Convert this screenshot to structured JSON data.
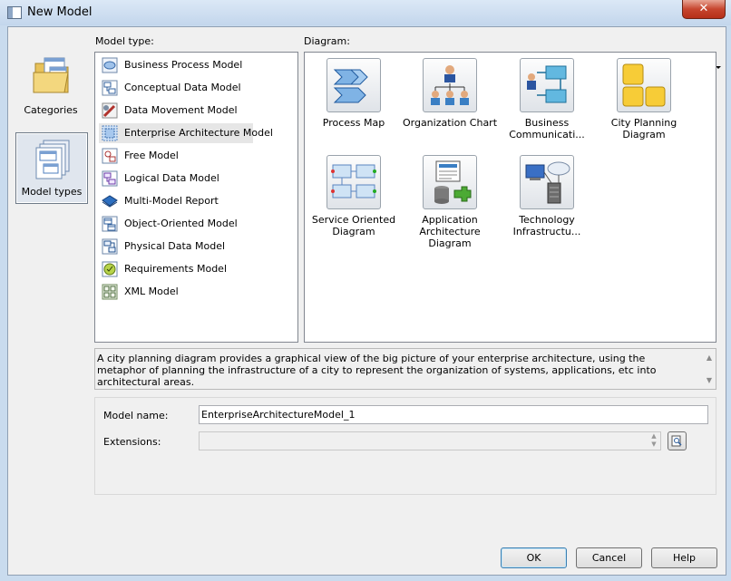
{
  "window": {
    "title": "New Model",
    "close_glyph": "✕"
  },
  "categories": [
    {
      "label": "Categories",
      "icon": "folder-icon",
      "selected": false
    },
    {
      "label": "Model types",
      "icon": "model-types-icon",
      "selected": true
    }
  ],
  "model_type_label": "Model type:",
  "diagram_label": "Diagram:",
  "model_types": [
    {
      "label": "Business Process Model",
      "icon": "business-process-model-icon"
    },
    {
      "label": "Conceptual Data Model",
      "icon": "conceptual-data-model-icon"
    },
    {
      "label": "Data Movement Model",
      "icon": "data-movement-model-icon"
    },
    {
      "label": "Enterprise Architecture Model",
      "icon": "enterprise-architecture-model-icon",
      "selected": true
    },
    {
      "label": "Free Model",
      "icon": "free-model-icon"
    },
    {
      "label": "Logical Data Model",
      "icon": "logical-data-model-icon"
    },
    {
      "label": "Multi-Model Report",
      "icon": "multi-model-report-icon"
    },
    {
      "label": "Object-Oriented Model",
      "icon": "object-oriented-model-icon"
    },
    {
      "label": "Physical Data Model",
      "icon": "physical-data-model-icon"
    },
    {
      "label": "Requirements Model",
      "icon": "requirements-model-icon"
    },
    {
      "label": "XML Model",
      "icon": "xml-model-icon"
    }
  ],
  "diagrams": [
    {
      "line1": "Process Map",
      "line2": "",
      "icon": "process-map-icon"
    },
    {
      "line1": "Organization Chart",
      "line2": "",
      "icon": "organization-chart-icon"
    },
    {
      "line1": "Business",
      "line2": "Communicati...",
      "icon": "business-communication-icon"
    },
    {
      "line1": "City Planning Diagram",
      "line2": "",
      "icon": "city-planning-icon"
    },
    {
      "line1": "Service Oriented",
      "line2": "Diagram",
      "icon": "service-oriented-icon"
    },
    {
      "line1": "Application",
      "line2": "Architecture Diagram",
      "icon": "application-architecture-icon"
    },
    {
      "line1": "Technology",
      "line2": "Infrastructu...",
      "icon": "technology-infrastructure-icon"
    }
  ],
  "description": "A city planning diagram provides a graphical view of the big picture of your enterprise architecture, using the metaphor of planning the infrastructure of a city to represent the organization of systems, applications, etc into architectural areas.",
  "form": {
    "model_name_label": "Model name:",
    "model_name_value": "EnterpriseArchitectureModel_1",
    "extensions_label": "Extensions:",
    "extensions_value": ""
  },
  "buttons": {
    "ok": "OK",
    "cancel": "Cancel",
    "help": "Help"
  },
  "colors": {
    "selection": "#e6e6e6",
    "title_bar": "#c9dbee",
    "close": "#c7462f"
  }
}
